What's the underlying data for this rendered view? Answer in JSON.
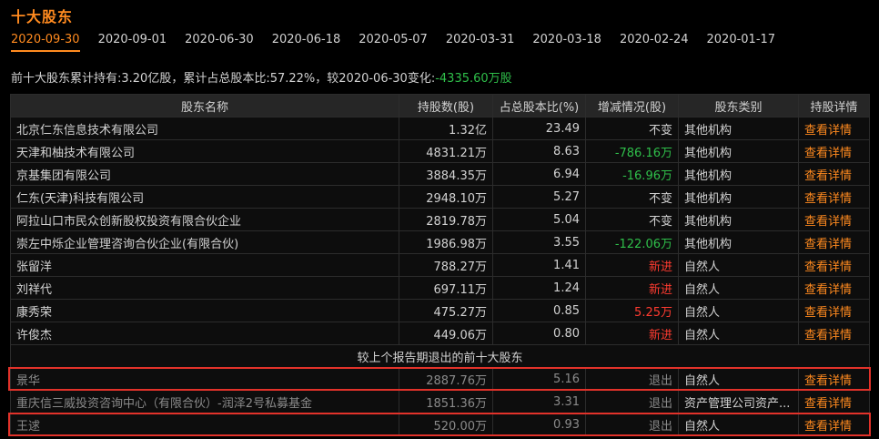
{
  "title": "十大股东",
  "tabs": [
    "2020-09-30",
    "2020-09-01",
    "2020-06-30",
    "2020-06-18",
    "2020-05-07",
    "2020-03-31",
    "2020-03-18",
    "2020-02-24",
    "2020-01-17"
  ],
  "summary": {
    "prefix": "前十大股东累计持有:3.20亿股，累计占总股本比:57.22%，较2020-06-30变化:",
    "change": "-4335.60万股"
  },
  "columns": [
    "股东名称",
    "持股数(股)",
    "占总股本比(%)",
    "增减情况(股)",
    "股东类别",
    "持股详情"
  ],
  "rows": [
    {
      "name": "北京仁东信息技术有限公司",
      "shares": "1.32亿",
      "pct": "23.49",
      "change": "不变",
      "change_type": "flat",
      "category": "其他机构",
      "detail": "查看详情"
    },
    {
      "name": "天津和柚技术有限公司",
      "shares": "4831.21万",
      "pct": "8.63",
      "change": "-786.16万",
      "change_type": "neg",
      "category": "其他机构",
      "detail": "查看详情"
    },
    {
      "name": "京基集团有限公司",
      "shares": "3884.35万",
      "pct": "6.94",
      "change": "-16.96万",
      "change_type": "neg",
      "category": "其他机构",
      "detail": "查看详情"
    },
    {
      "name": "仁东(天津)科技有限公司",
      "shares": "2948.10万",
      "pct": "5.27",
      "change": "不变",
      "change_type": "flat",
      "category": "其他机构",
      "detail": "查看详情"
    },
    {
      "name": "阿拉山口市民众创新股权投资有限合伙企业",
      "shares": "2819.78万",
      "pct": "5.04",
      "change": "不变",
      "change_type": "flat",
      "category": "其他机构",
      "detail": "查看详情"
    },
    {
      "name": "崇左中烁企业管理咨询合伙企业(有限合伙)",
      "shares": "1986.98万",
      "pct": "3.55",
      "change": "-122.06万",
      "change_type": "neg",
      "category": "其他机构",
      "detail": "查看详情"
    },
    {
      "name": "张留洋",
      "shares": "788.27万",
      "pct": "1.41",
      "change": "新进",
      "change_type": "new",
      "category": "自然人",
      "detail": "查看详情"
    },
    {
      "name": "刘祥代",
      "shares": "697.11万",
      "pct": "1.24",
      "change": "新进",
      "change_type": "new",
      "category": "自然人",
      "detail": "查看详情"
    },
    {
      "name": "康秀荣",
      "shares": "475.27万",
      "pct": "0.85",
      "change": "5.25万",
      "change_type": "pos",
      "category": "自然人",
      "detail": "查看详情"
    },
    {
      "name": "许俊杰",
      "shares": "449.06万",
      "pct": "0.80",
      "change": "新进",
      "change_type": "new",
      "category": "自然人",
      "detail": "查看详情"
    }
  ],
  "divider": "较上个报告期退出的前十大股东",
  "exited_rows": [
    {
      "name": "景华",
      "shares": "2887.76万",
      "pct": "5.16",
      "change": "退出",
      "category": "自然人",
      "detail": "查看详情"
    },
    {
      "name": "重庆信三威投资咨询中心（有限合伙）-润泽2号私募基金",
      "shares": "1851.36万",
      "pct": "3.31",
      "change": "退出",
      "category": "资产管理公司资产...",
      "detail": "查看详情"
    },
    {
      "name": "王逑",
      "shares": "520.00万",
      "pct": "0.93",
      "change": "退出",
      "category": "自然人",
      "detail": "查看详情"
    }
  ],
  "highlight_color": "#e2322a",
  "accent_color": "#ff8a1f"
}
